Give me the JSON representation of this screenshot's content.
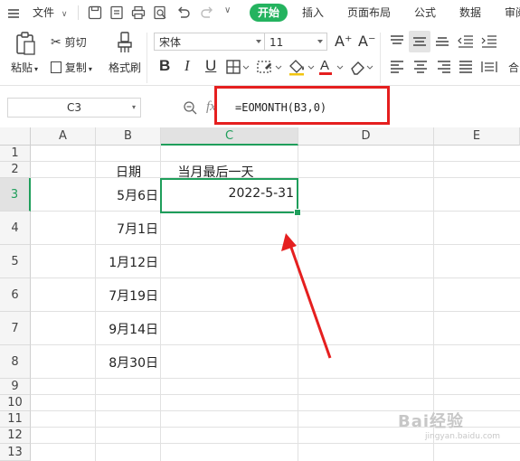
{
  "menu": {
    "file_label": "文件",
    "tabs": [
      "开始",
      "插入",
      "页面布局",
      "公式",
      "数据",
      "审阅"
    ]
  },
  "ribbon": {
    "paste_label": "粘贴",
    "cut_label": "剪切",
    "copy_label": "复制",
    "format_painter_label": "格式刷",
    "font_name": "宋体",
    "font_size": "11",
    "font_grow": "A⁺",
    "font_shrink": "A⁻",
    "bold": "B",
    "italic": "I",
    "underline": "U",
    "merge_label": "合",
    "accent_color": "#24b35f",
    "font_color_bar": "#e51f1f"
  },
  "formula_bar": {
    "cell_ref": "C3",
    "fx_label": "fx",
    "formula": "=EOMONTH(B3,0)"
  },
  "grid": {
    "columns": [
      "A",
      "B",
      "C",
      "D",
      "E"
    ],
    "rows": [
      "1",
      "2",
      "3",
      "4",
      "5",
      "6",
      "7",
      "8",
      "9",
      "10",
      "11",
      "12",
      "13"
    ],
    "header_B2": "日期",
    "header_C2": "当月最后一天",
    "dates": [
      "5月6日",
      "7月1日",
      "1月12日",
      "7月19日",
      "9月14日",
      "8月30日"
    ],
    "result_C3": "2022-5-31"
  },
  "annotation": {
    "highlight_color": "#e51f1f",
    "selection_color": "#1f9e5b"
  },
  "watermark": {
    "text": "Bai经验",
    "sub": "jingyan.baidu.com"
  }
}
